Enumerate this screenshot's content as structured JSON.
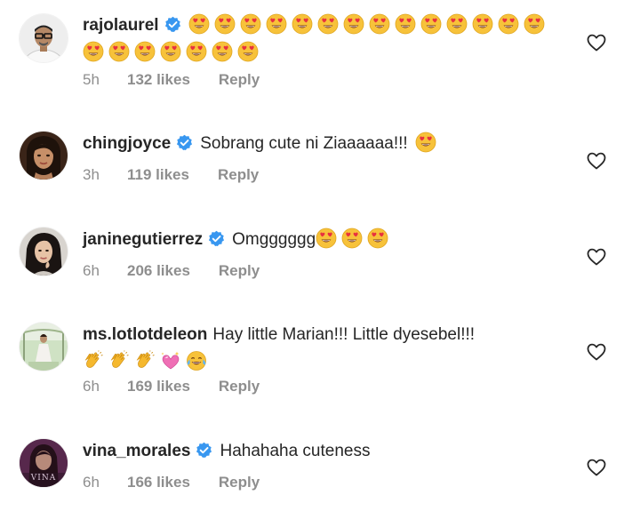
{
  "comments": [
    {
      "username": "rajolaurel",
      "verified": true,
      "text": "",
      "emoji_count": 21,
      "emoji": "heart-eyes",
      "time": "5h",
      "likes": "132 likes",
      "reply": "Reply"
    },
    {
      "username": "chingjoyce",
      "verified": true,
      "text": "Sobrang cute ni Ziaaaaaa!!!",
      "emoji_count": 1,
      "emoji": "heart-eyes",
      "time": "3h",
      "likes": "119 likes",
      "reply": "Reply"
    },
    {
      "username": "janinegutierrez",
      "verified": true,
      "text": "Omgggggg",
      "emoji_count": 3,
      "emoji": "heart-eyes",
      "time": "6h",
      "likes": "206 likes",
      "reply": "Reply"
    },
    {
      "username": "ms.lotlotdeleon",
      "verified": false,
      "text": "Hay little Marian!!! Little dyesebel!!!",
      "emojis": [
        "clapping-hands",
        "clapping-hands",
        "clapping-hands",
        "sparkling-heart",
        "tears-of-joy"
      ],
      "time": "6h",
      "likes": "169 likes",
      "reply": "Reply"
    },
    {
      "username": "vina_morales",
      "verified": true,
      "text": "Hahahaha cuteness",
      "emoji_count": 0,
      "time": "6h",
      "likes": "166 likes",
      "reply": "Reply",
      "avatar_text": "VINA"
    }
  ],
  "colors": {
    "text": "#262626",
    "muted": "#8e8e8e",
    "verified": "#3897f0"
  },
  "icons": {
    "like": "heart-outline-icon",
    "verified": "verified-badge-icon"
  }
}
